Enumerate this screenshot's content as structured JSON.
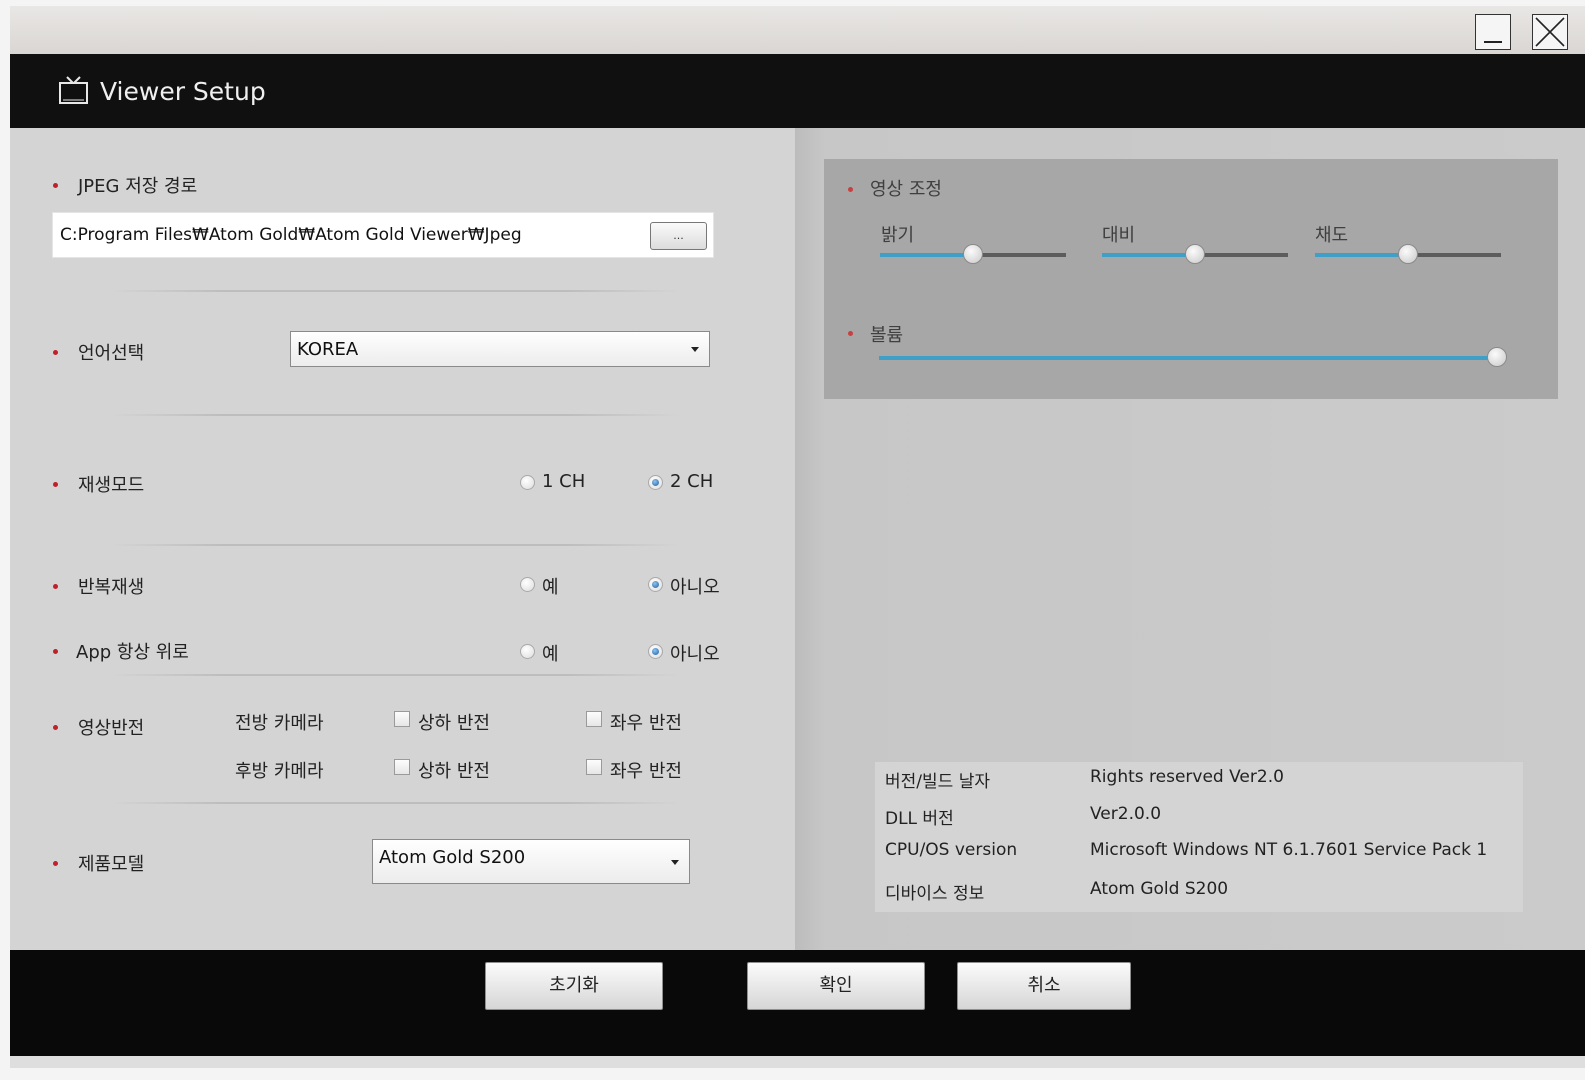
{
  "window": {
    "minimize_label": "_",
    "close_label": "X"
  },
  "header": {
    "icon": "tv-icon",
    "title": "Viewer Setup"
  },
  "settings": {
    "jpeg_path": {
      "label": "JPEG 저장 경로",
      "value": "C:Program Files₩Atom Gold₩Atom Gold Viewer₩Jpeg",
      "browse_label": "..."
    },
    "language": {
      "label": "언어선택",
      "selected": "KOREA"
    },
    "play_mode": {
      "label": "재생모드",
      "options": [
        "1 CH",
        "2 CH"
      ],
      "selected": "2 CH"
    },
    "repeat_play": {
      "label": "반복재생",
      "options": [
        "예",
        "아니오"
      ],
      "selected": "아니오"
    },
    "app_always_on_top": {
      "label": "App 항상 위로",
      "options": [
        "예",
        "아니오"
      ],
      "selected": "아니오"
    },
    "image_flip": {
      "label": "영상반전",
      "front_camera": {
        "label": "전방 카메라",
        "vertical_flip": {
          "label": "상하 반전",
          "checked": false
        },
        "horizontal_flip": {
          "label": "좌우 반전",
          "checked": false
        }
      },
      "rear_camera": {
        "label": "후방 카메라",
        "vertical_flip": {
          "label": "상하 반전",
          "checked": false
        },
        "horizontal_flip": {
          "label": "좌우 반전",
          "checked": false
        }
      }
    },
    "product_model": {
      "label": "제품모델",
      "selected": "Atom Gold S200"
    }
  },
  "image_adjust": {
    "label": "영상 조정",
    "brightness": {
      "label": "밝기",
      "level": 0.5
    },
    "contrast": {
      "label": "대비",
      "level": 0.5
    },
    "saturation": {
      "label": "채도",
      "level": 0.5
    }
  },
  "volume": {
    "label": "볼륨",
    "level": 1.0
  },
  "info": {
    "rows": [
      {
        "key": "버전/빌드 날자",
        "value": "Rights reserved Ver2.0"
      },
      {
        "key": "DLL 버전",
        "value": "Ver2.0.0"
      },
      {
        "key": "CPU/OS version",
        "value": "Microsoft Windows NT 6.1.7601 Service Pack 1"
      },
      {
        "key": "디바이스 정보",
        "value": "Atom Gold S200"
      }
    ]
  },
  "footer": {
    "reset_label": "초기화",
    "ok_label": "확인",
    "cancel_label": "취소"
  },
  "colors": {
    "accent_slider": "#3f9fc6",
    "bullet": "#c0202a",
    "header_bg": "#101010"
  }
}
